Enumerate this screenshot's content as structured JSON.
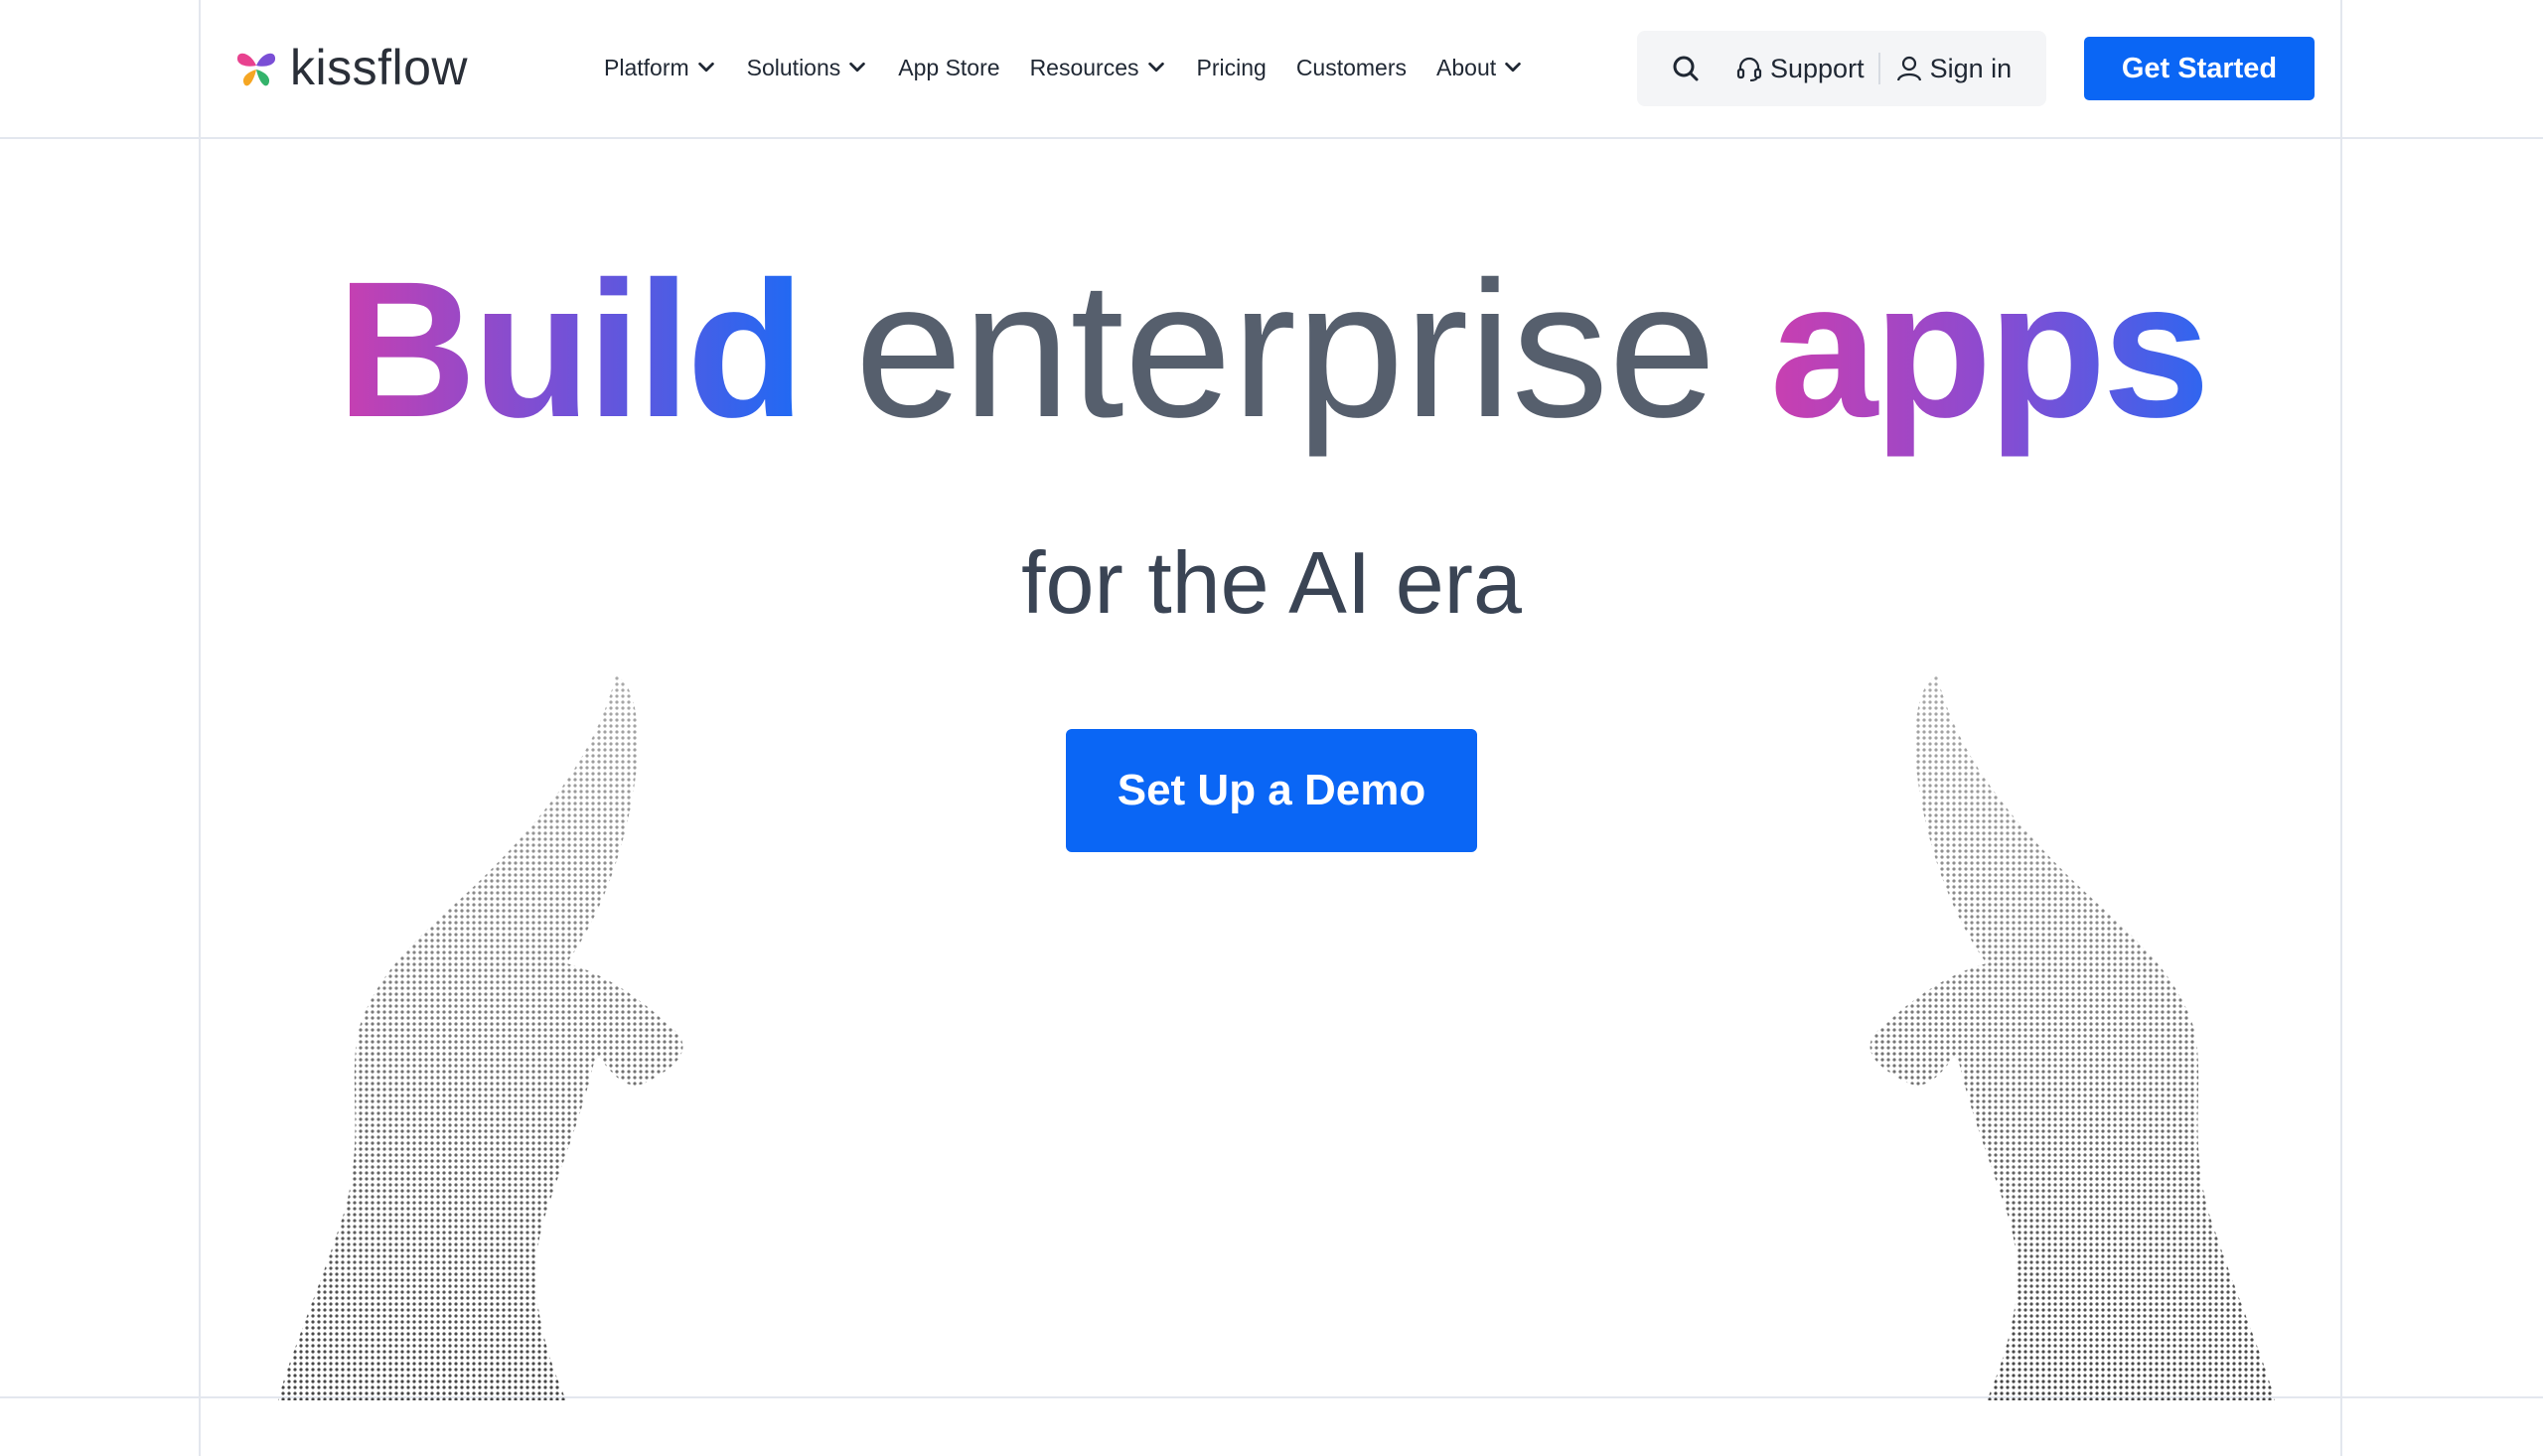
{
  "brand": {
    "name": "kissflow",
    "colors": {
      "primary": "#0a66f5",
      "gradient_start": "#c93fb0",
      "gradient_mid": "#7b4fd4",
      "gradient_end": "#1f6af4"
    }
  },
  "nav": {
    "items": [
      {
        "label": "Platform",
        "has_dropdown": true
      },
      {
        "label": "Solutions",
        "has_dropdown": true
      },
      {
        "label": "App Store",
        "has_dropdown": false
      },
      {
        "label": "Resources",
        "has_dropdown": true
      },
      {
        "label": "Pricing",
        "has_dropdown": false
      },
      {
        "label": "Customers",
        "has_dropdown": false
      },
      {
        "label": "About",
        "has_dropdown": true
      }
    ]
  },
  "utility": {
    "search_icon": "search-icon",
    "support_label": "Support",
    "support_icon": "headset-icon",
    "signin_label": "Sign in",
    "signin_icon": "user-icon"
  },
  "header_cta": {
    "label": "Get Started"
  },
  "hero": {
    "title_word1": "Build",
    "title_word2": "enterprise",
    "title_word3": "apps",
    "subtitle": "for the AI era",
    "cta_label": "Set Up a Demo"
  }
}
